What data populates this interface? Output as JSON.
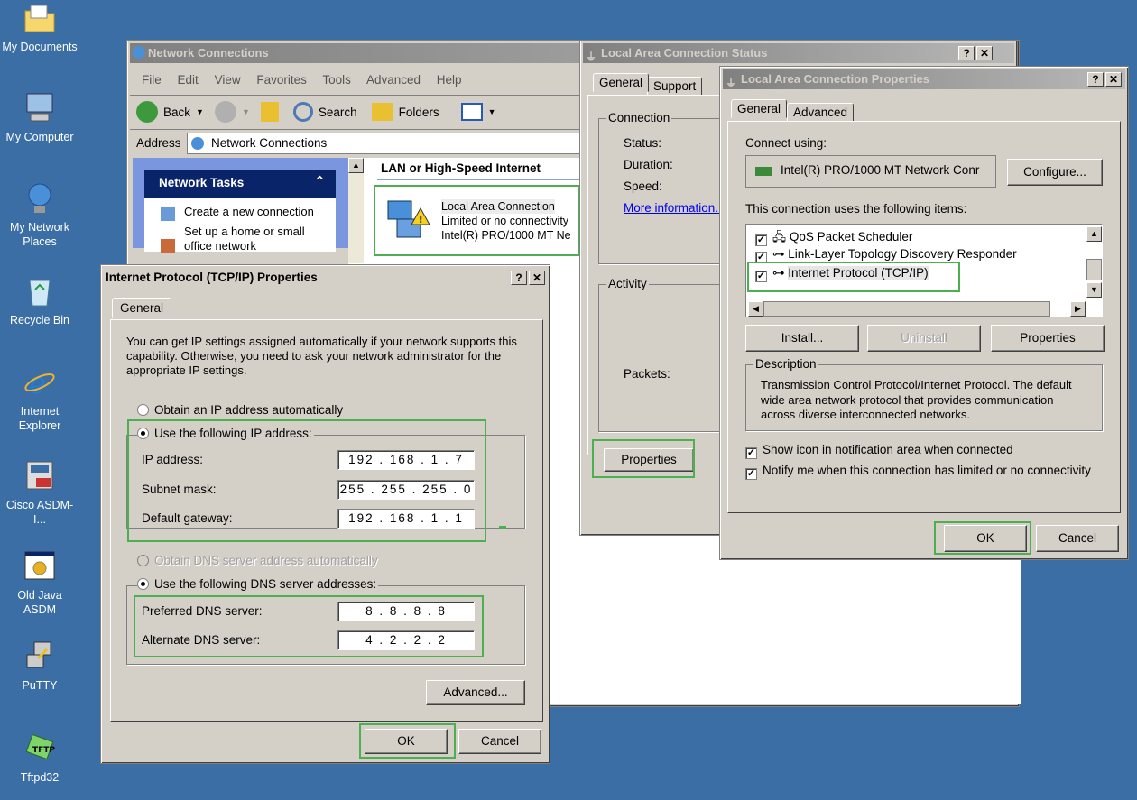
{
  "desktop": {
    "icons": [
      {
        "label": "My Documents",
        "icon": "folder-documents-icon"
      },
      {
        "label": "My Computer",
        "icon": "computer-icon"
      },
      {
        "label": "My Network Places",
        "icon": "network-places-icon"
      },
      {
        "label": "Recycle Bin",
        "icon": "recycle-bin-icon"
      },
      {
        "label": "Internet Explorer",
        "icon": "internet-explorer-icon"
      },
      {
        "label": "Cisco ASDM-I...",
        "icon": "cisco-asdm-icon"
      },
      {
        "label": "Old Java ASDM",
        "icon": "java-asdm-icon"
      },
      {
        "label": "PuTTY",
        "icon": "putty-icon"
      },
      {
        "label": "Tftpd32",
        "icon": "tftpd-icon"
      }
    ]
  },
  "netconn": {
    "title": "Network Connections",
    "menu": [
      "File",
      "Edit",
      "View",
      "Favorites",
      "Tools",
      "Advanced",
      "Help"
    ],
    "toolbar": {
      "back": "Back",
      "search": "Search",
      "folders": "Folders"
    },
    "address_label": "Address",
    "address_value": "Network Connections",
    "tasks_title": "Network Tasks",
    "tasks": [
      "Create a new connection",
      "Set up a home or small office network"
    ],
    "section_header": "LAN or High-Speed Internet",
    "connection": {
      "name": "Local Area Connection",
      "status": "Limited or no connectivity",
      "adapter": "Intel(R) PRO/1000 MT Ne"
    }
  },
  "status_dialog": {
    "title": "Local Area Connection Status",
    "tabs": [
      "General",
      "Support"
    ],
    "connection_group": "Connection",
    "labels": [
      "Status:",
      "Duration:",
      "Speed:"
    ],
    "more_info": "More information...",
    "activity_group": "Activity",
    "packets_label": "Packets:",
    "properties_button": "Properties"
  },
  "props_dialog": {
    "title": "Local Area Connection Properties",
    "tabs": [
      "General",
      "Advanced"
    ],
    "connect_using_label": "Connect using:",
    "adapter": "Intel(R) PRO/1000 MT Network Conr",
    "configure_button": "Configure...",
    "items_label": "This connection uses the following items:",
    "items": [
      {
        "label": "QoS Packet Scheduler",
        "checked": true
      },
      {
        "label": "Link-Layer Topology Discovery Responder",
        "checked": true
      },
      {
        "label": "Internet Protocol (TCP/IP)",
        "checked": true
      }
    ],
    "install_button": "Install...",
    "uninstall_button": "Uninstall",
    "properties_button": "Properties",
    "description_group": "Description",
    "description": "Transmission Control Protocol/Internet Protocol. The default wide area network protocol that provides communication across diverse interconnected networks.",
    "show_icon": "Show icon in notification area when connected",
    "notify": "Notify me when this connection has limited or no connectivity",
    "ok_button": "OK",
    "cancel_button": "Cancel"
  },
  "tcpip": {
    "title": "Internet Protocol (TCP/IP) Properties",
    "tab": "General",
    "intro": "You can get IP settings assigned automatically if your network supports this capability. Otherwise, you need to ask your network administrator for the appropriate IP settings.",
    "auto_ip": "Obtain an IP address automatically",
    "use_ip": "Use the following IP address:",
    "ip_label": "IP address:",
    "ip_value": "192 . 168 . 1 . 7",
    "mask_label": "Subnet mask:",
    "mask_value": "255 . 255 . 255 . 0",
    "gw_label": "Default gateway:",
    "gw_value": "192 . 168 . 1 . 1",
    "auto_dns": "Obtain DNS server address automatically",
    "use_dns": "Use the following DNS server addresses:",
    "pref_dns_label": "Preferred DNS server:",
    "pref_dns_value": "8 . 8 . 8 . 8",
    "alt_dns_label": "Alternate DNS server:",
    "alt_dns_value": "4 . 2 . 2 . 2",
    "advanced_button": "Advanced...",
    "ok_button": "OK",
    "cancel_button": "Cancel"
  }
}
